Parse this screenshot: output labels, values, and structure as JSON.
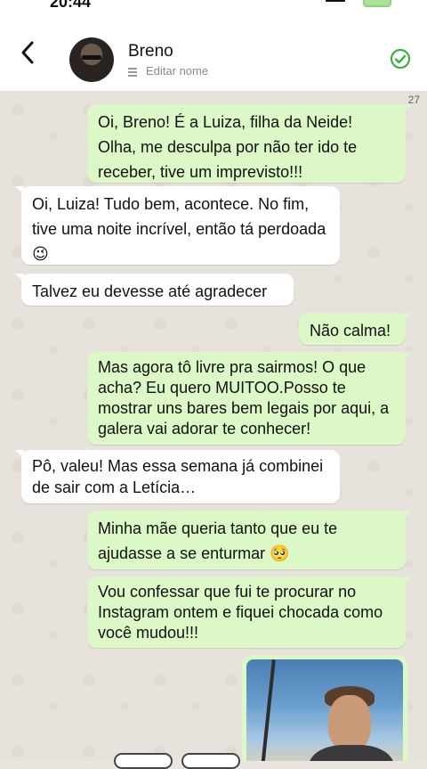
{
  "status": {
    "time": "20:44"
  },
  "header": {
    "contact_name": "Breno",
    "edit_label": "Editar nome"
  },
  "chat": {
    "count": "27",
    "messages": [
      {
        "dir": "out",
        "text": "Oi, Breno! É a Luiza, filha da Neide! Olha, me desculpa por não ter ido te receber, tive um imprevisto!!!"
      },
      {
        "dir": "in",
        "text": "Oi, Luiza! Tudo bem, acontece. No fim, tive uma noite incrível, então tá perdoada 😉"
      },
      {
        "dir": "in",
        "text": "Talvez eu devesse até agradecer"
      },
      {
        "dir": "out",
        "text": "Não calma!"
      },
      {
        "dir": "out",
        "text": "Mas agora tô livre pra sairmos! O que acha? Eu quero MUITOO.Posso te mostrar uns bares bem legais por aqui, a galera vai adorar te conhecer!"
      },
      {
        "dir": "in",
        "text": "Pô, valeu! Mas essa semana já combinei de sair com a Letícia…"
      },
      {
        "dir": "out",
        "text": "Minha mãe queria tanto que eu te ajudasse a se enturmar 🥺"
      },
      {
        "dir": "out",
        "text": "Vou confessar que fui te procurar no Instagram ontem e fiquei chocada como você mudou!!!"
      }
    ]
  },
  "colors": {
    "outgoing": "#dcf8c6",
    "incoming": "#ffffff",
    "accent": "#3cb043"
  }
}
